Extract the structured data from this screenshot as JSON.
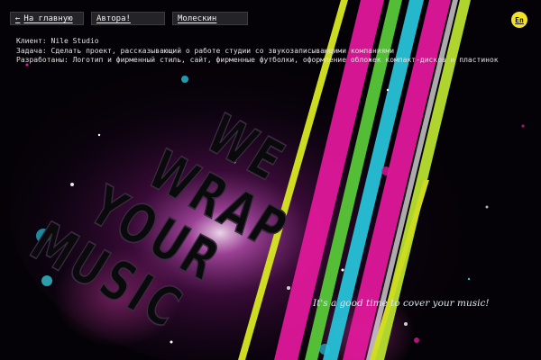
{
  "nav": {
    "home_label": "На главную",
    "authors_label": "Автора!",
    "moleskin_label": "Молескин"
  },
  "lang_switch": "En",
  "project_info": {
    "client": "Клиент: Nile Studio",
    "task": "Задача: Сделать проект, рассказывающий о работе студии со звукозаписывающими компаниями",
    "developed": "Разработаны: Логотип и фирменный стиль, сайт, фирменные футболки, оформление обложек компакт-дисков и пластинок"
  },
  "artwork": {
    "slogan_lines": [
      "WE",
      "WRAP",
      "YOUR",
      "MUSIC"
    ],
    "tagline": "It's a good time to cover your music!"
  },
  "colors": {
    "accent_yellow": "#f2e32a",
    "stripe_magenta": "#e0189a",
    "stripe_cyan": "#27c2d8",
    "stripe_green": "#58c838",
    "stripe_yellow": "#d8e820"
  }
}
